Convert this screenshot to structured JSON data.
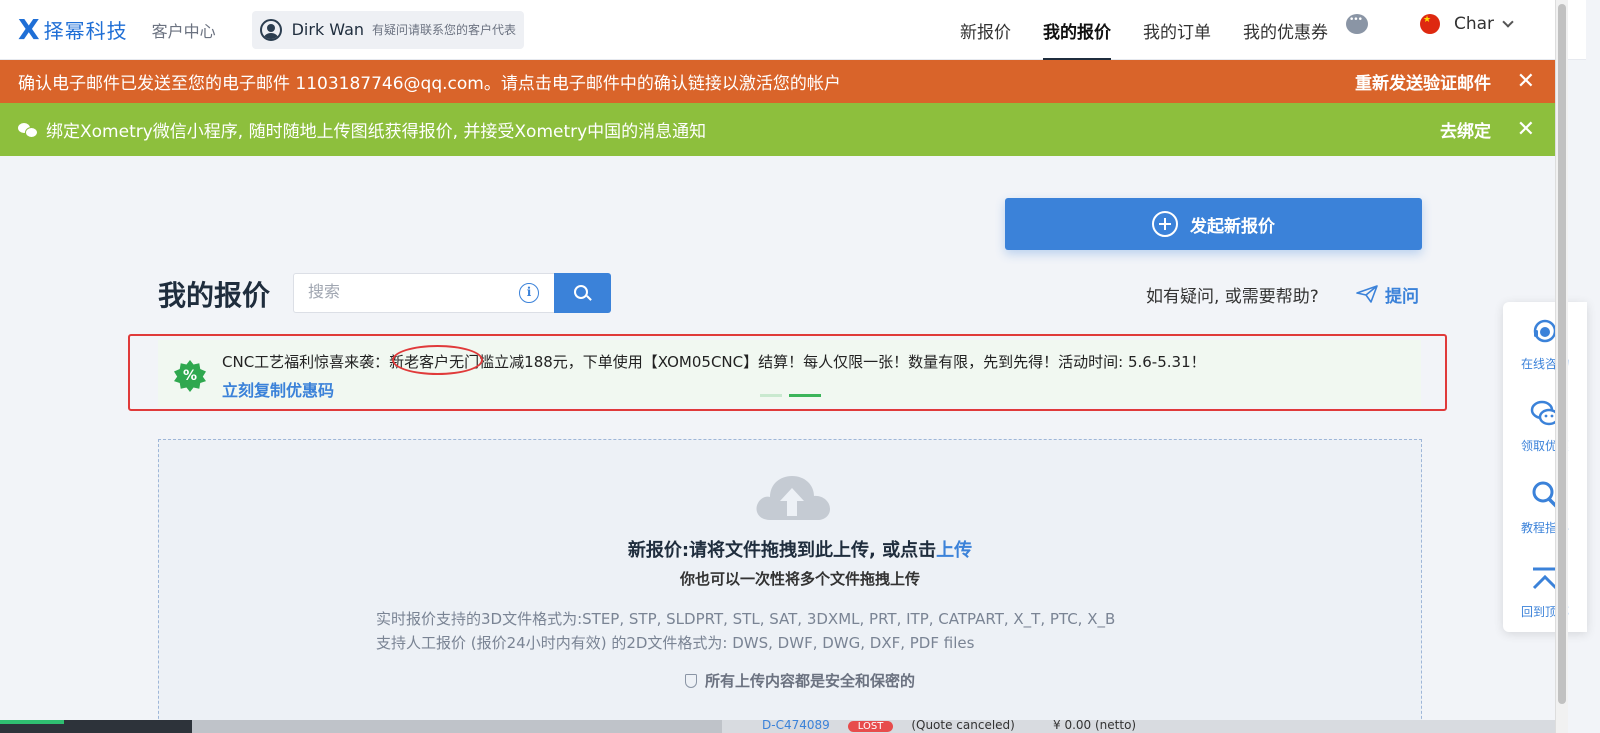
{
  "header": {
    "logo_mark": "X",
    "logo_text": "择幂科技",
    "customer_center": "客户中心",
    "rep": {
      "name": "Dirk Wan",
      "hint": "有疑问请联系您的客户代表"
    },
    "nav": [
      {
        "label": "新报价"
      },
      {
        "label": "我的报价",
        "active": true
      },
      {
        "label": "我的订单"
      },
      {
        "label": "我的优惠券"
      }
    ],
    "language": "Char"
  },
  "banners": {
    "email": {
      "text": "确认电子邮件已发送至您的电子邮件 1103187746@qq.com。请点击电子邮件中的确认链接以激活您的帐户",
      "action": "重新发送验证邮件",
      "close": "✕",
      "color": "#d9642a"
    },
    "wechat": {
      "text": "绑定Xometry微信小程序, 随时随地上传图纸获得报价, 并接受Xometry中国的消息通知",
      "action": "去绑定",
      "close": "✕",
      "color": "#8dbf3d"
    }
  },
  "actions": {
    "new_quote": "发起新报价"
  },
  "page": {
    "title": "我的报价",
    "search_placeholder": "搜索",
    "help_text": "如有疑问, 或需要帮助?",
    "ask_label": "提问"
  },
  "promo": {
    "icon": "%",
    "text": "CNC工艺福利惊喜来袭：新老客户无门槛立减188元，下单使用【XOM05CNC】结算！每人仅限一张！数量有限，先到先得！活动时间: 5.6-5.31！",
    "link": "立刻复制优惠码"
  },
  "upload": {
    "title_prefix": "新报价:请将文件拖拽到此上传, 或点击",
    "title_link": "上传",
    "subtitle": "你也可以一次性将多个文件拖拽上传",
    "formats_3d": "实时报价支持的3D文件格式为:STEP, STP, SLDPRT, STL, SAT, 3DXML, PRT, ITP, CATPART, X_T, PTC, X_B",
    "formats_2d": "支持人工报价 (报价24小时内有效) 的2D文件格式为: DWS, DWF, DWG, DXF, PDF files",
    "secure": "所有上传内容都是安全和保密的"
  },
  "bottom_row": {
    "id": "D-C474089",
    "status": "LOST",
    "note": "(Quote canceled)",
    "amount": "¥ 0.00 (netto)"
  },
  "side_widget": [
    {
      "label": "在线咨询",
      "icon": "headset-icon"
    },
    {
      "label": "领取优惠",
      "icon": "wechat-icon"
    },
    {
      "label": "教程指导",
      "icon": "magnifier-icon"
    },
    {
      "label": "回到顶部",
      "icon": "back-to-top-icon"
    }
  ]
}
